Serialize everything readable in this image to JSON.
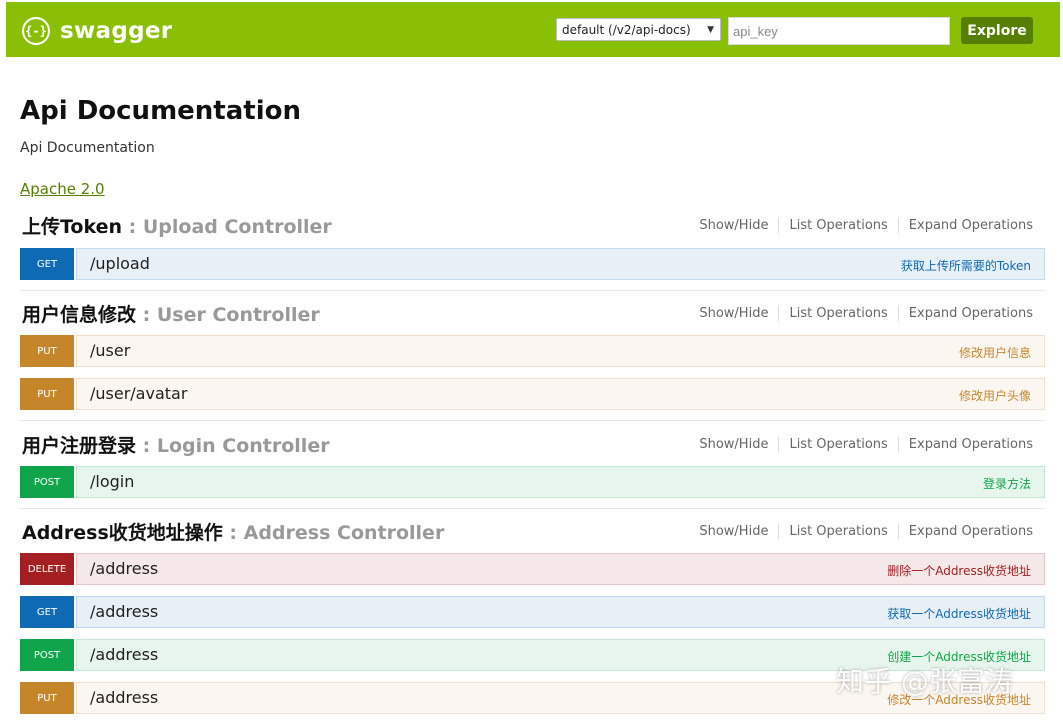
{
  "header": {
    "logo_text": "swagger",
    "logo_icon": "{-}",
    "spec_select_value": "default (/v2/api-docs)",
    "api_key_placeholder": "api_key",
    "explore_label": "Explore"
  },
  "info": {
    "title": "Api Documentation",
    "description": "Api Documentation",
    "license": "Apache 2.0"
  },
  "section_links": {
    "show_hide": "Show/Hide",
    "list_operations": "List Operations",
    "expand_operations": "Expand Operations"
  },
  "sections": [
    {
      "title": "上传Token",
      "sep": " : ",
      "controller": "Upload Controller",
      "operations": [
        {
          "method": "GET",
          "path": "/upload",
          "summary": "获取上传所需要的Token"
        }
      ]
    },
    {
      "title": "用户信息修改",
      "sep": " : ",
      "controller": "User Controller",
      "operations": [
        {
          "method": "PUT",
          "path": "/user",
          "summary": "修改用户信息"
        },
        {
          "method": "PUT",
          "path": "/user/avatar",
          "summary": "修改用户头像"
        }
      ]
    },
    {
      "title": "用户注册登录",
      "sep": " : ",
      "controller": "Login Controller",
      "operations": [
        {
          "method": "POST",
          "path": "/login",
          "summary": "登录方法"
        }
      ]
    },
    {
      "title": "Address收货地址操作",
      "sep": " : ",
      "controller": "Address Controller",
      "operations": [
        {
          "method": "DELETE",
          "path": "/address",
          "summary": "删除一个Address收货地址"
        },
        {
          "method": "GET",
          "path": "/address",
          "summary": "获取一个Address收货地址"
        },
        {
          "method": "POST",
          "path": "/address",
          "summary": "创建一个Address收货地址"
        },
        {
          "method": "PUT",
          "path": "/address",
          "summary": "修改一个Address收货地址"
        }
      ]
    }
  ],
  "watermark": "知乎 @张富涛"
}
